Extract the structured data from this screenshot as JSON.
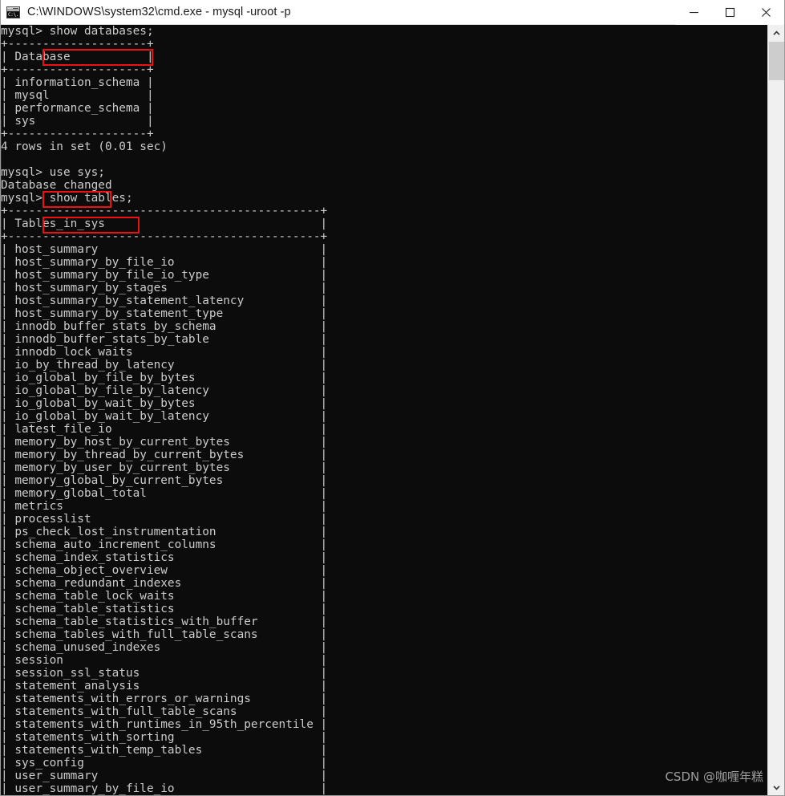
{
  "window": {
    "title": "C:\\WINDOWS\\system32\\cmd.exe - mysql  -uroot -p",
    "app_icon_label": "C:\\.",
    "minimize_label": "Minimize",
    "maximize_label": "Maximize",
    "close_label": "Close"
  },
  "scrollbar": {
    "up_label": "Scroll up",
    "down_label": "Scroll down"
  },
  "watermark": {
    "text": "CSDN @咖喱年糕"
  },
  "terminal": {
    "prompt": "mysql>",
    "commands": [
      {
        "text": "show databases;",
        "highlighted": true
      },
      {
        "text": "use sys;",
        "highlighted": true
      },
      {
        "text": "show tables;",
        "highlighted": true
      }
    ],
    "databases_table": {
      "header": "Database",
      "rows": [
        "information_schema",
        "mysql",
        "performance_schema",
        "sys"
      ],
      "footer": "4 rows in set (0.01 sec)"
    },
    "database_changed_message": "Database changed",
    "tables_table": {
      "header": "Tables_in_sys",
      "rows": [
        "host_summary",
        "host_summary_by_file_io",
        "host_summary_by_file_io_type",
        "host_summary_by_stages",
        "host_summary_by_statement_latency",
        "host_summary_by_statement_type",
        "innodb_buffer_stats_by_schema",
        "innodb_buffer_stats_by_table",
        "innodb_lock_waits",
        "io_by_thread_by_latency",
        "io_global_by_file_by_bytes",
        "io_global_by_file_by_latency",
        "io_global_by_wait_by_bytes",
        "io_global_by_wait_by_latency",
        "latest_file_io",
        "memory_by_host_by_current_bytes",
        "memory_by_thread_by_current_bytes",
        "memory_by_user_by_current_bytes",
        "memory_global_by_current_bytes",
        "memory_global_total",
        "metrics",
        "processlist",
        "ps_check_lost_instrumentation",
        "schema_auto_increment_columns",
        "schema_index_statistics",
        "schema_object_overview",
        "schema_redundant_indexes",
        "schema_table_lock_waits",
        "schema_table_statistics",
        "schema_table_statistics_with_buffer",
        "schema_tables_with_full_table_scans",
        "schema_unused_indexes",
        "session",
        "session_ssl_status",
        "statement_analysis",
        "statements_with_errors_or_warnings",
        "statements_with_full_table_scans",
        "statements_with_runtimes_in_95th_percentile",
        "statements_with_sorting",
        "statements_with_temp_tables",
        "sys_config",
        "user_summary",
        "user_summary_by_file_io"
      ]
    },
    "screen_text": ""
  },
  "colors": {
    "terminal_bg": "#0c0c0c",
    "terminal_fg": "#cccccc",
    "annotation_red": "#ee1111",
    "titlebar_bg": "#ffffff",
    "scrollbar_track": "#f0f0f0",
    "scrollbar_thumb": "#cdcdcd"
  }
}
